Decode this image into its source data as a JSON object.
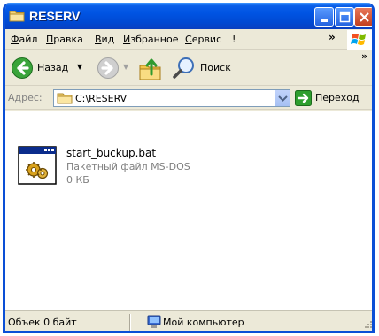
{
  "window": {
    "title": "RESERV",
    "colors": {
      "titlebar": "#0054e3",
      "chrome": "#ece9d8",
      "content": "#ffffff"
    }
  },
  "menu": {
    "items": [
      "Файл",
      "Правка",
      "Вид",
      "Избранное",
      "Сервис",
      "!"
    ],
    "overflow": "»"
  },
  "toolbar": {
    "back_label": "Назад",
    "search_label": "Поиск",
    "overflow": "»",
    "icons": [
      "back-arrow-icon",
      "forward-arrow-icon",
      "folder-up-icon",
      "search-magnifier-icon"
    ]
  },
  "address": {
    "label": "Адрес:",
    "value": "C:\\RESERV",
    "go_label": "Переход"
  },
  "files": [
    {
      "name": "start_buckup.bat",
      "type": "Пакетный файл MS-DOS",
      "size": "0 КБ",
      "icon": "batch-file-icon"
    }
  ],
  "status": {
    "objects": "Объек 0 байт",
    "location": "Мой компьютер"
  }
}
